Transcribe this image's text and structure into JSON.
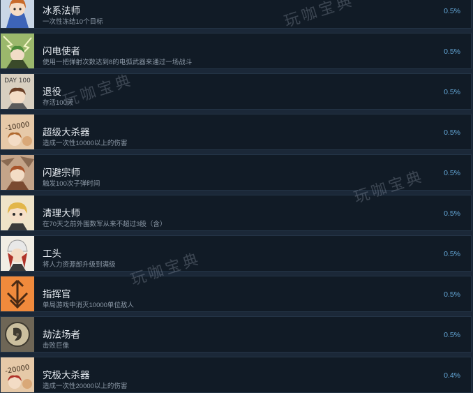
{
  "achievements": [
    {
      "title": "冰系法师",
      "desc": "一次性冻结10个目标",
      "percent": "0.5%",
      "icon": "ice-mage-icon",
      "icon_bg": "#c9d6e6"
    },
    {
      "title": "闪电使者",
      "desc": "使用一把弹射次数达到8的电弧武器来通过一场战斗",
      "percent": "0.5%",
      "icon": "lightning-envoy-icon",
      "icon_bg": "#9bb86c"
    },
    {
      "title": "退役",
      "desc": "存活100天",
      "percent": "0.5%",
      "icon": "retire-icon",
      "icon_bg": "#d8cfc0",
      "icon_text": "DAY 100"
    },
    {
      "title": "超级大杀器",
      "desc": "造成一次性10000以上的伤害",
      "percent": "0.5%",
      "icon": "super-killer-icon",
      "icon_bg": "#e6c9a8",
      "icon_text": "-10000"
    },
    {
      "title": "闪避宗师",
      "desc": "触发100次子弹时间",
      "percent": "0.5%",
      "icon": "dodge-master-icon",
      "icon_bg": "#c4a489"
    },
    {
      "title": "清理大师",
      "desc": "在70天之前外围数军从来不超过3股（含）",
      "percent": "0.5%",
      "icon": "cleanup-master-icon",
      "icon_bg": "#efe3c8"
    },
    {
      "title": "工头",
      "desc": "将人力资源部升级到满级",
      "percent": "0.5%",
      "icon": "foreman-icon",
      "icon_bg": "#f1ede4"
    },
    {
      "title": "指挥官",
      "desc": "单局游戏中消灭10000单位敌人",
      "percent": "0.5%",
      "icon": "commander-icon",
      "icon_bg": "#f08a3c"
    },
    {
      "title": "劫法场者",
      "desc": "击败巨像",
      "percent": "0.5%",
      "icon": "execution-raider-icon",
      "icon_bg": "#6e6656"
    },
    {
      "title": "究极大杀器",
      "desc": "造成一次性20000以上的伤害",
      "percent": "0.4%",
      "icon": "ultimate-killer-icon",
      "icon_bg": "#e6c9a8",
      "icon_text": "-20000"
    }
  ],
  "watermark": "玩咖宝典"
}
